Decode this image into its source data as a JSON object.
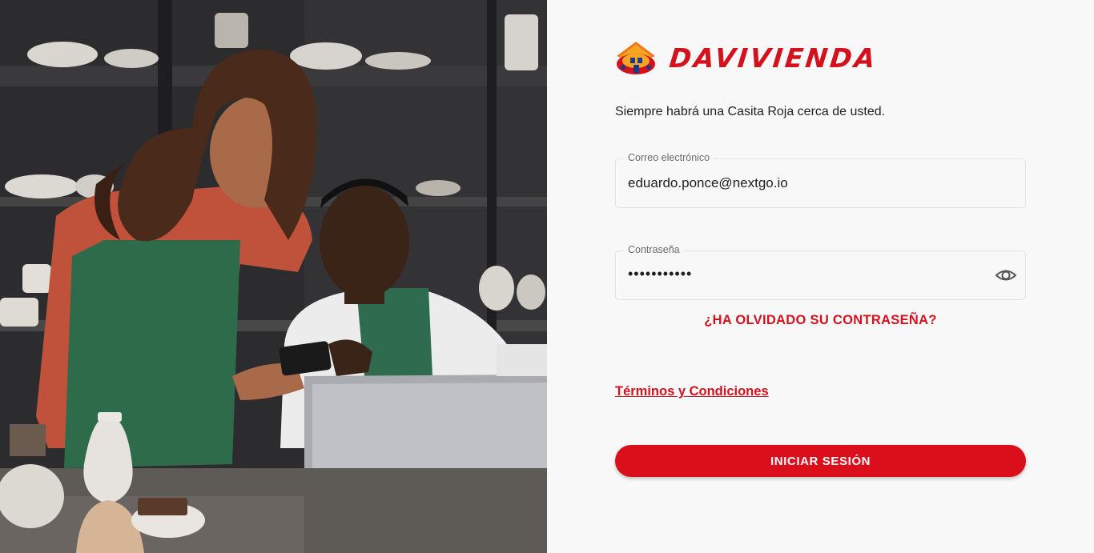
{
  "brand": {
    "name": "DAVIVIENDA",
    "color": "#d4121e"
  },
  "tagline": "Siempre habrá una Casita Roja cerca de usted.",
  "form": {
    "email": {
      "label": "Correo electrónico",
      "value": "eduardo.ponce@nextgo.io"
    },
    "password": {
      "label": "Contraseña",
      "value": "•••••••••••",
      "toggle_icon": "eye-icon"
    },
    "forgot_link": "¿HA OLVIDADO SU CONTRASEÑA?",
    "terms_link": "Términos y Condiciones",
    "submit_label": "INICIAR SESIÓN"
  },
  "colors": {
    "accent": "#da0f1b",
    "background": "#f8f8f8"
  }
}
